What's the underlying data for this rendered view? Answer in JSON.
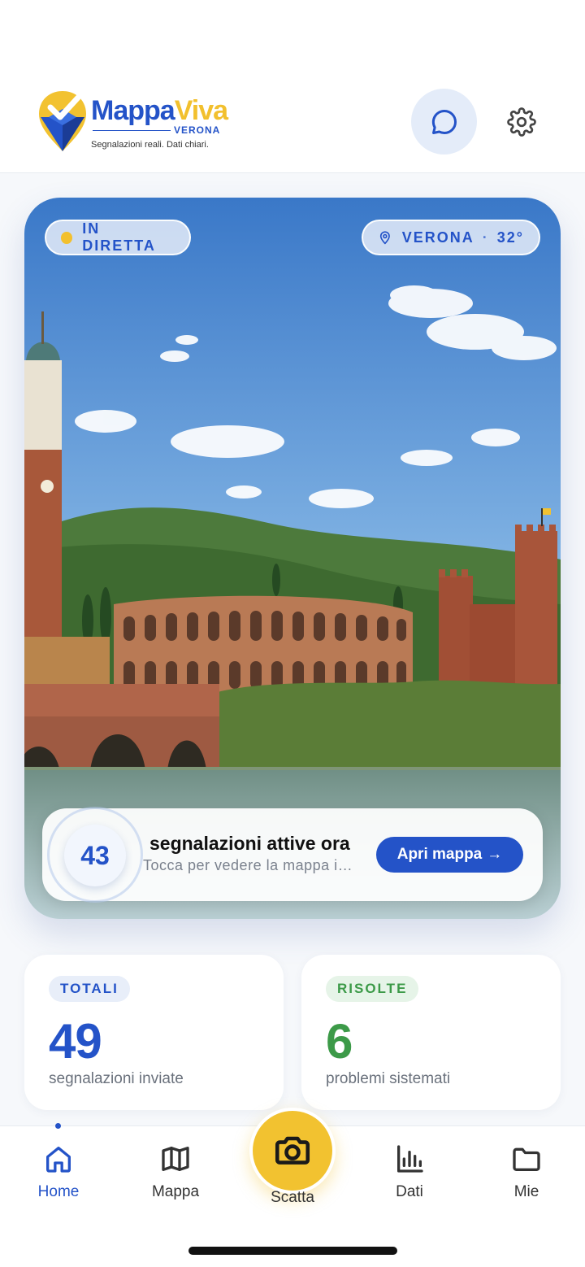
{
  "app": {
    "brand_part1": "Mappa",
    "brand_part2": "Viva",
    "city": "VERONA",
    "tagline": "Segnalazioni reali. Dati chiari."
  },
  "header": {
    "chat_icon": "chat-bubble-icon",
    "settings_icon": "gear-icon"
  },
  "hero": {
    "live_label": "IN DIRETTA",
    "location": "VERONA",
    "separator": "·",
    "temperature": "32°",
    "active_count": "43",
    "active_title": "segnalazioni attive ora",
    "active_subtitle": "Tocca per vedere la mappa in tempo reale",
    "open_map_label": "Apri mappa",
    "open_map_arrow": "→"
  },
  "stats": {
    "total": {
      "tag": "TOTALI",
      "value": "49",
      "label": "segnalazioni inviate"
    },
    "resolved": {
      "tag": "RISOLTE",
      "value": "6",
      "label": "problemi sistemati"
    }
  },
  "tabs": {
    "home": "Home",
    "map": "Mappa",
    "camera": "Scatta",
    "data": "Dati",
    "mine": "Mie"
  },
  "colors": {
    "accent": "#2453c8",
    "yellow": "#f2c230",
    "green": "#3c9a48"
  }
}
